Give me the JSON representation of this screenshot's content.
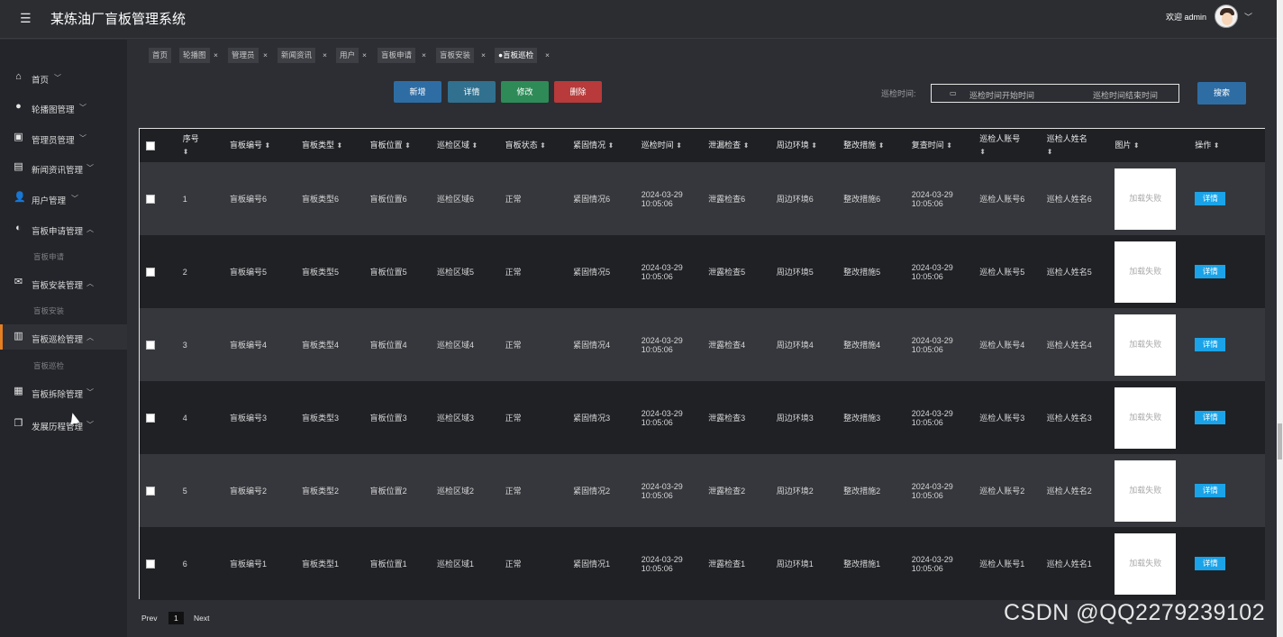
{
  "app": {
    "title": "某炼油厂盲板管理系统",
    "welcome": "欢迎 admin"
  },
  "sidebar": {
    "items": [
      {
        "label": "首页",
        "icon": "home-icon",
        "chev": "﹀"
      },
      {
        "label": "轮播图管理",
        "icon": "carousel-icon",
        "chev": "﹀"
      },
      {
        "label": "管理员管理",
        "icon": "admin-icon",
        "chev": "﹀"
      },
      {
        "label": "新闻资讯管理",
        "icon": "news-icon",
        "chev": "﹀"
      },
      {
        "label": "用户管理",
        "icon": "user-icon",
        "chev": "﹀"
      },
      {
        "label": "盲板申请管理",
        "icon": "apply-icon",
        "chev": "︿"
      },
      {
        "label": "盲板安装管理",
        "icon": "install-icon",
        "chev": "︿"
      },
      {
        "label": "盲板巡检管理",
        "icon": "inspect-icon",
        "chev": "︿"
      },
      {
        "label": "盲板拆除管理",
        "icon": "remove-icon",
        "chev": "﹀"
      },
      {
        "label": "发展历程管理",
        "icon": "history-icon",
        "chev": "﹀"
      }
    ],
    "subs": [
      "盲板申请",
      "盲板安装",
      "盲板巡检"
    ]
  },
  "tabs": [
    "首页",
    "轮播图",
    "管理员",
    "新闻资讯",
    "用户",
    "盲板申请",
    "盲板安装",
    "●盲板巡检"
  ],
  "toolbar": {
    "add": "新增",
    "detail": "详情",
    "edit": "修改",
    "delete": "删除",
    "search": "搜索"
  },
  "search": {
    "label": "巡检时间:",
    "start_placeholder": "巡检时间开始时间",
    "end_placeholder": "巡检时间结束时间"
  },
  "table": {
    "headers": [
      "序号",
      "盲板编号",
      "盲板类型",
      "盲板位置",
      "巡检区域",
      "盲板状态",
      "紧固情况",
      "巡检时间",
      "泄漏检查",
      "周边环境",
      "整改措施",
      "复查时间",
      "巡检人账号",
      "巡检人姓名",
      "图片",
      "操作"
    ],
    "rows": [
      {
        "no": "1",
        "code": "盲板编号6",
        "type": "盲板类型6",
        "pos": "盲板位置6",
        "area": "巡检区域6",
        "status": "正常",
        "fasten": "紧固情况6",
        "t1a": "2024-03-29",
        "t1b": "10:05:06",
        "leak": "泄露检查6",
        "env": "周边环境6",
        "fix": "整改措施6",
        "t2a": "2024-03-29",
        "t2b": "10:05:06",
        "acct": "巡检人账号6",
        "name": "巡检人姓名6",
        "img": "加载失败",
        "op": "详情"
      },
      {
        "no": "2",
        "code": "盲板编号5",
        "type": "盲板类型5",
        "pos": "盲板位置5",
        "area": "巡检区域5",
        "status": "正常",
        "fasten": "紧固情况5",
        "t1a": "2024-03-29",
        "t1b": "10:05:06",
        "leak": "泄露检查5",
        "env": "周边环境5",
        "fix": "整改措施5",
        "t2a": "2024-03-29",
        "t2b": "10:05:06",
        "acct": "巡检人账号5",
        "name": "巡检人姓名5",
        "img": "加载失败",
        "op": "详情"
      },
      {
        "no": "3",
        "code": "盲板编号4",
        "type": "盲板类型4",
        "pos": "盲板位置4",
        "area": "巡检区域4",
        "status": "正常",
        "fasten": "紧固情况4",
        "t1a": "2024-03-29",
        "t1b": "10:05:06",
        "leak": "泄露检查4",
        "env": "周边环境4",
        "fix": "整改措施4",
        "t2a": "2024-03-29",
        "t2b": "10:05:06",
        "acct": "巡检人账号4",
        "name": "巡检人姓名4",
        "img": "加载失败",
        "op": "详情"
      },
      {
        "no": "4",
        "code": "盲板编号3",
        "type": "盲板类型3",
        "pos": "盲板位置3",
        "area": "巡检区域3",
        "status": "正常",
        "fasten": "紧固情况3",
        "t1a": "2024-03-29",
        "t1b": "10:05:06",
        "leak": "泄露检查3",
        "env": "周边环境3",
        "fix": "整改措施3",
        "t2a": "2024-03-29",
        "t2b": "10:05:06",
        "acct": "巡检人账号3",
        "name": "巡检人姓名3",
        "img": "加载失败",
        "op": "详情"
      },
      {
        "no": "5",
        "code": "盲板编号2",
        "type": "盲板类型2",
        "pos": "盲板位置2",
        "area": "巡检区域2",
        "status": "正常",
        "fasten": "紧固情况2",
        "t1a": "2024-03-29",
        "t1b": "10:05:06",
        "leak": "泄露检查2",
        "env": "周边环境2",
        "fix": "整改措施2",
        "t2a": "2024-03-29",
        "t2b": "10:05:06",
        "acct": "巡检人账号2",
        "name": "巡检人姓名2",
        "img": "加载失败",
        "op": "详情"
      },
      {
        "no": "6",
        "code": "盲板编号1",
        "type": "盲板类型1",
        "pos": "盲板位置1",
        "area": "巡检区域1",
        "status": "正常",
        "fasten": "紧固情况1",
        "t1a": "2024-03-29",
        "t1b": "10:05:06",
        "leak": "泄露检查1",
        "env": "周边环境1",
        "fix": "整改措施1",
        "t2a": "2024-03-29",
        "t2b": "10:05:06",
        "acct": "巡检人账号1",
        "name": "巡检人姓名1",
        "img": "加载失败",
        "op": "详情"
      }
    ]
  },
  "pager": {
    "prev": "Prev",
    "page": "1",
    "next": "Next"
  },
  "watermark": "CSDN @QQ2279239102",
  "colors": {
    "accent": "#e67e22",
    "primary": "#2e6da4",
    "info": "#1aa3e8",
    "danger": "#b83a3a",
    "success": "#2e8b57"
  }
}
